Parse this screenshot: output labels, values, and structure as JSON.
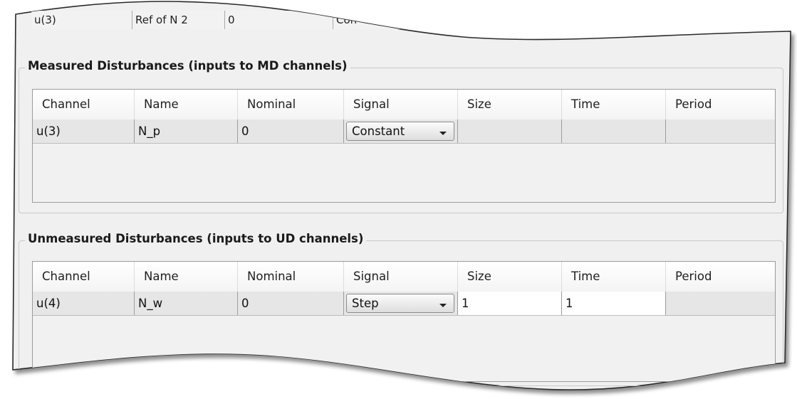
{
  "partial_row": {
    "channel": "u(3)",
    "name": "Ref of N 2",
    "nominal": "0",
    "signal": "Con"
  },
  "measured": {
    "title": "Measured Disturbances (inputs to MD channels)",
    "columns": [
      "Channel",
      "Name",
      "Nominal",
      "Signal",
      "Size",
      "Time",
      "Period"
    ],
    "row": {
      "channel": "u(3)",
      "name": "N_p",
      "nominal": "0",
      "signal": "Constant",
      "size": "",
      "time": "",
      "period": ""
    }
  },
  "unmeasured": {
    "title": "Unmeasured Disturbances (inputs to UD channels)",
    "columns": [
      "Channel",
      "Name",
      "Nominal",
      "Signal",
      "Size",
      "Time",
      "Period"
    ],
    "row": {
      "channel": "u(4)",
      "name": "N_w",
      "nominal": "0",
      "signal": "Step",
      "size": "1",
      "time": "1",
      "period": ""
    }
  },
  "icons": {
    "dropdown": "chevron-down-icon"
  },
  "colors": {
    "panel_background": "#f0f0f0",
    "row_background": "#e6e6e6",
    "editable_cell": "#ffffff"
  }
}
